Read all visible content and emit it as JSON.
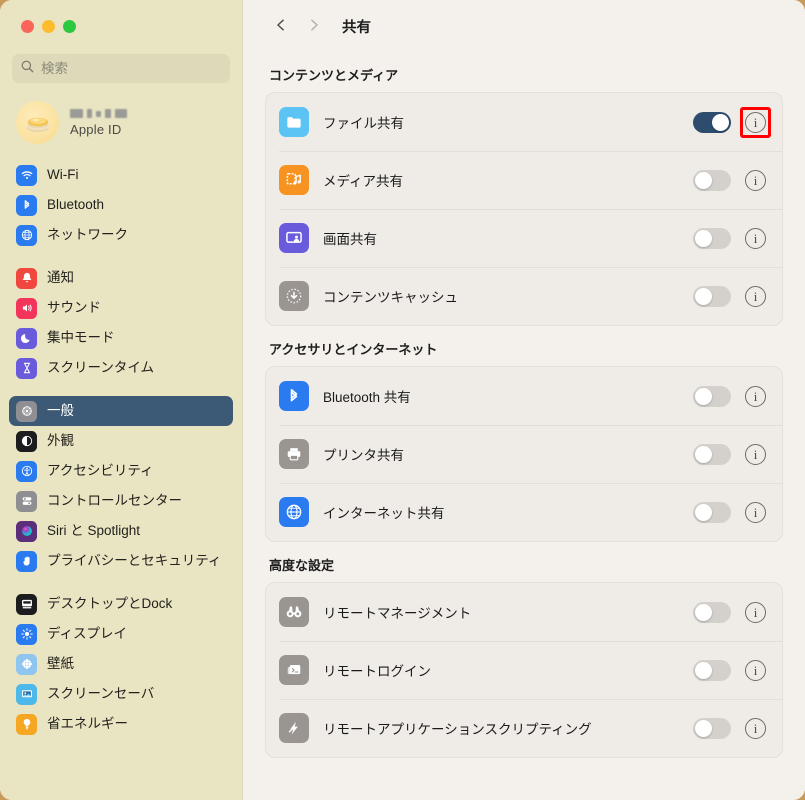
{
  "window": {
    "traffic_lights": [
      "close",
      "minimize",
      "zoom"
    ],
    "sidebar_bg": "#e9e5c3",
    "main_bg": "#f4f0ec",
    "accent_selected": "#3c5a76",
    "toggle_on_color": "#2d4c6e",
    "highlight_color": "#ff0000"
  },
  "search": {
    "placeholder": "検索",
    "value": "",
    "icon": "search-icon"
  },
  "account": {
    "name_redacted": true,
    "subtitle": "Apple ID",
    "avatar_icon": "memoji-avatar"
  },
  "sidebar": {
    "groups": [
      {
        "items": [
          {
            "label": "Wi-Fi",
            "icon": "wifi-icon",
            "color": "#2a7af0",
            "selected": false
          },
          {
            "label": "Bluetooth",
            "icon": "bluetooth-icon",
            "color": "#2a7af0",
            "selected": false
          },
          {
            "label": "ネットワーク",
            "icon": "network-globe-icon",
            "color": "#2a7af0",
            "selected": false
          }
        ]
      },
      {
        "items": [
          {
            "label": "通知",
            "icon": "notifications-bell-icon",
            "color": "#f0483e",
            "selected": false
          },
          {
            "label": "サウンド",
            "icon": "sound-speaker-icon",
            "color": "#f3355b",
            "selected": false
          },
          {
            "label": "集中モード",
            "icon": "focus-moon-icon",
            "color": "#6a5bdd",
            "selected": false
          },
          {
            "label": "スクリーンタイム",
            "icon": "screen-time-hourglass-icon",
            "color": "#6a5bdd",
            "selected": false
          }
        ]
      },
      {
        "items": [
          {
            "label": "一般",
            "icon": "general-gear-icon",
            "color": "#8e8e93",
            "selected": true
          },
          {
            "label": "外観",
            "icon": "appearance-contrast-icon",
            "color": "#1c1c1e",
            "selected": false
          },
          {
            "label": "アクセシビリティ",
            "icon": "accessibility-icon",
            "color": "#2a7af0",
            "selected": false
          },
          {
            "label": "コントロールセンター",
            "icon": "control-center-icon",
            "color": "#8e8e93",
            "selected": false
          },
          {
            "label": "Siri と Spotlight",
            "icon": "siri-orb-icon",
            "color": "#5b2d7a",
            "selected": false
          },
          {
            "label": "プライバシーとセキュリティ",
            "icon": "privacy-hand-icon",
            "color": "#2a7af0",
            "selected": false
          }
        ]
      },
      {
        "items": [
          {
            "label": "デスクトップとDock",
            "icon": "desktop-dock-icon",
            "color": "#1c1c1e",
            "selected": false
          },
          {
            "label": "ディスプレイ",
            "icon": "display-brightness-icon",
            "color": "#2a7af0",
            "selected": false
          },
          {
            "label": "壁紙",
            "icon": "wallpaper-flower-icon",
            "color": "#8ec6ef",
            "selected": false
          },
          {
            "label": "スクリーンセーバ",
            "icon": "screensaver-icon",
            "color": "#4db8ea",
            "selected": false
          },
          {
            "label": "省エネルギー",
            "icon": "energy-bulb-icon",
            "color": "#f5a623",
            "selected": false
          }
        ]
      }
    ]
  },
  "main": {
    "nav": {
      "back_icon": "chevron-left-icon",
      "forward_icon": "chevron-right-icon"
    },
    "title": "共有",
    "sections": [
      {
        "title": "コンテンツとメディア",
        "rows": [
          {
            "label": "ファイル共有",
            "icon": "file-sharing-folder-icon",
            "color": "#5bc4f5",
            "toggle": true,
            "info_highlighted": true,
            "info_icon": "info-icon"
          },
          {
            "label": "メディア共有",
            "icon": "media-sharing-music-icon",
            "color": "#f79421",
            "toggle": false,
            "info_highlighted": false,
            "info_icon": "info-icon"
          },
          {
            "label": "画面共有",
            "icon": "screen-sharing-icon",
            "color": "#6a5bdd",
            "toggle": false,
            "info_highlighted": false,
            "info_icon": "info-icon"
          },
          {
            "label": "コンテンツキャッシュ",
            "icon": "content-caching-download-icon",
            "color": "#9a9590",
            "toggle": false,
            "info_highlighted": false,
            "info_icon": "info-icon"
          }
        ]
      },
      {
        "title": "アクセサリとインターネット",
        "rows": [
          {
            "label": "Bluetooth 共有",
            "icon": "bluetooth-sharing-icon",
            "color": "#2a7af0",
            "toggle": false,
            "info_highlighted": false,
            "info_icon": "info-icon"
          },
          {
            "label": "プリンタ共有",
            "icon": "printer-sharing-icon",
            "color": "#9a9590",
            "toggle": false,
            "info_highlighted": false,
            "info_icon": "info-icon"
          },
          {
            "label": "インターネット共有",
            "icon": "internet-sharing-globe-icon",
            "color": "#2a7af0",
            "toggle": false,
            "info_highlighted": false,
            "info_icon": "info-icon"
          }
        ]
      },
      {
        "title": "高度な設定",
        "rows": [
          {
            "label": "リモートマネージメント",
            "icon": "remote-management-binoculars-icon",
            "color": "#9a9590",
            "toggle": false,
            "info_highlighted": false,
            "info_icon": "info-icon"
          },
          {
            "label": "リモートログイン",
            "icon": "remote-login-terminal-icon",
            "color": "#9a9590",
            "toggle": false,
            "info_highlighted": false,
            "info_icon": "info-icon"
          },
          {
            "label": "リモートアプリケーションスクリプティング",
            "icon": "remote-apple-events-icon",
            "color": "#9a9590",
            "toggle": false,
            "info_highlighted": false,
            "info_icon": "info-icon"
          }
        ]
      }
    ]
  }
}
